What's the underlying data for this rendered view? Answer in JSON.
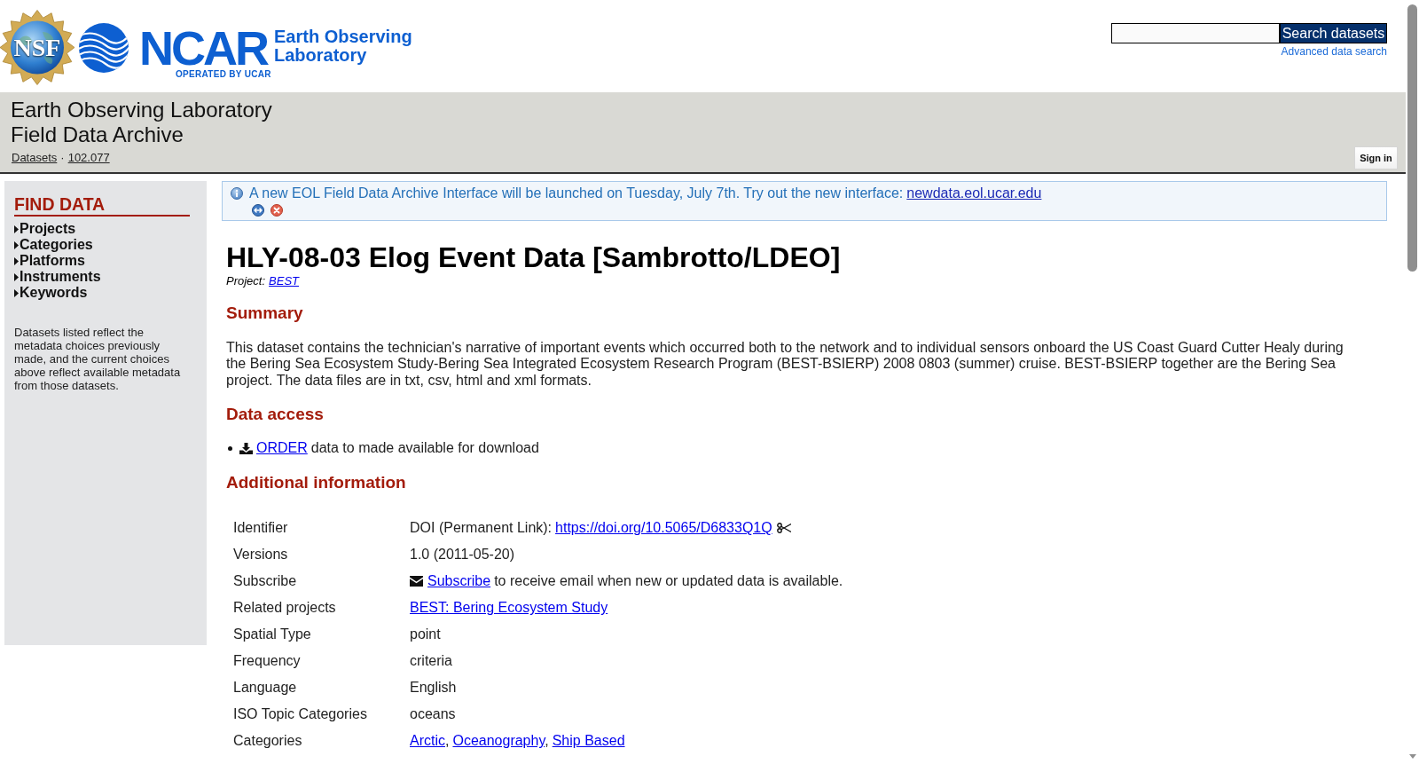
{
  "logos": {
    "nsf": "NSF",
    "ncar": {
      "wordmark": "NCAR",
      "lab_lines": [
        "Earth Observing",
        "Laboratory"
      ],
      "tagline": "OPERATED BY UCAR"
    }
  },
  "search": {
    "button": "Search datasets",
    "advanced_link": "Advanced data search"
  },
  "banner": {
    "title_lines": [
      "Earth Observing Laboratory",
      "Field Data Archive"
    ],
    "breadcrumbs": [
      "Datasets",
      "102.077"
    ],
    "breadcrumb_separator": "·",
    "sign_in": "Sign in"
  },
  "sidebar": {
    "heading": "FIND DATA",
    "items": [
      {
        "label": "Projects",
        "expanded": false
      },
      {
        "label": "Categories",
        "expanded": false
      },
      {
        "label": "Platforms",
        "expanded": false
      },
      {
        "label": "Instruments",
        "expanded": false
      },
      {
        "label": "Keywords",
        "expanded": false
      }
    ],
    "note": "Datasets listed reflect the metadata choices previously made, and the current choices above reflect available metadata from those datasets."
  },
  "notice": {
    "text": "A new EOL Field Data Archive Interface will be launched on Tuesday, July 7th. Try out the new interface:",
    "link": "newdata.eol.ucar.edu"
  },
  "dataset": {
    "title": "HLY-08-03 Elog Event Data [Sambrotto/LDEO]",
    "project_label": "Project:",
    "project_link": "BEST"
  },
  "summary": {
    "heading": "Summary",
    "text": "This dataset contains the technician's narrative of important events which occurred both to the network and to individual sensors onboard the US Coast Guard Cutter Healy during the Bering Sea Ecosystem Study-Bering Sea Integrated Ecosystem Research Program (BEST-BSIERP) 2008 0803 (summer) cruise. BEST-BSIERP together are the Bering Sea project. The data files are in txt, csv, html and xml formats."
  },
  "data_access": {
    "heading": "Data access",
    "items": [
      {
        "link": "ORDER",
        "text": "data to made available for download"
      }
    ]
  },
  "additional_info": {
    "heading": "Additional information",
    "rows": [
      {
        "kind": "doi",
        "label": "Identifier",
        "prefix": "DOI (Permanent Link):",
        "link": "https://doi.org/10.5065/D6833Q1Q"
      },
      {
        "kind": "text",
        "label": "Versions",
        "value": "1.0 (2011-05-20)"
      },
      {
        "kind": "subscribe",
        "label": "Subscribe",
        "link": "Subscribe",
        "suffix": "to receive email when new or updated data is available."
      },
      {
        "kind": "links",
        "label": "Related projects",
        "links": [
          "BEST: Bering Ecosystem Study"
        ]
      },
      {
        "kind": "text",
        "label": "Spatial Type",
        "value": "point"
      },
      {
        "kind": "text",
        "label": "Frequency",
        "value": "criteria"
      },
      {
        "kind": "text",
        "label": "Language",
        "value": "English"
      },
      {
        "kind": "text",
        "label": "ISO Topic Categories",
        "value": "oceans"
      },
      {
        "kind": "links",
        "label": "Categories",
        "links": [
          "Arctic",
          "Oceanography",
          "Ship Based"
        ],
        "separator": ","
      }
    ]
  }
}
